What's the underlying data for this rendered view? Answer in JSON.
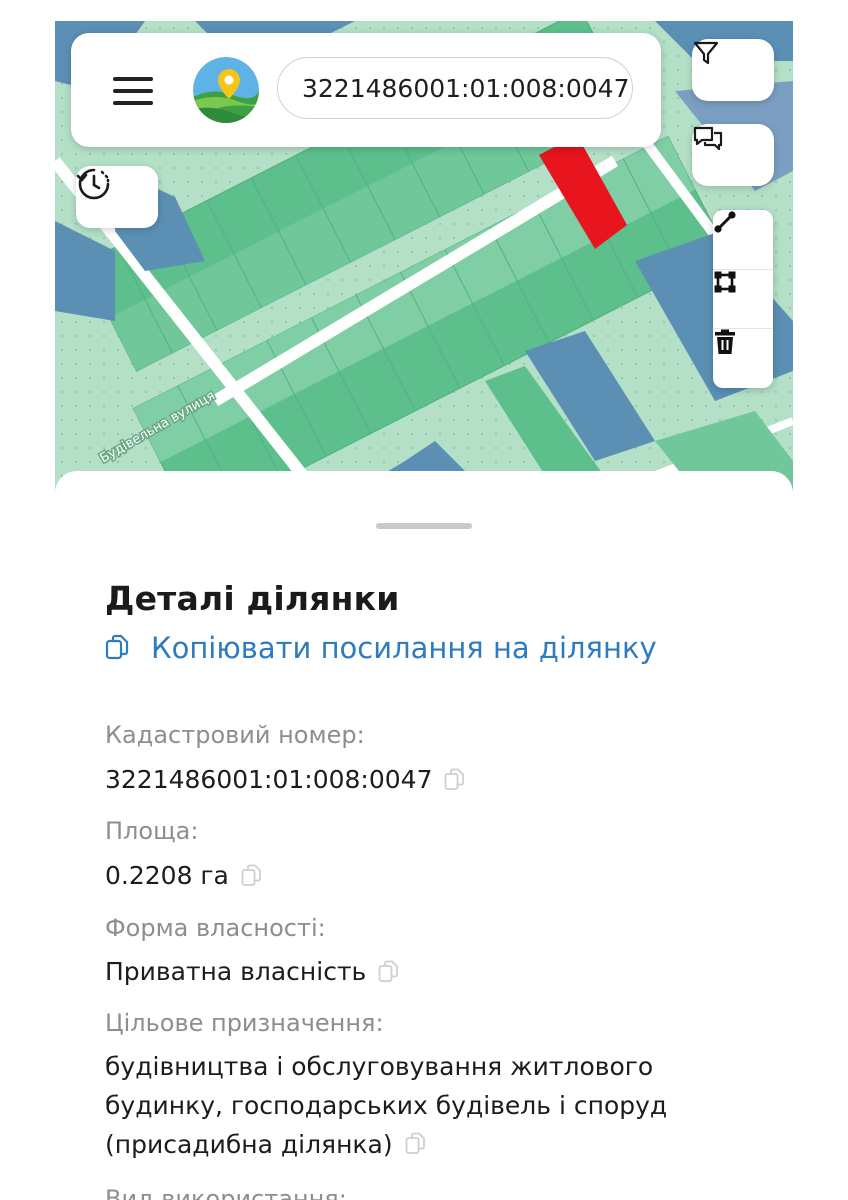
{
  "map": {
    "street_label": "Будівельна вулиця",
    "colors": {
      "parcel_green": "#5cbf8c",
      "parcel_light": "#7fcea6",
      "parcel_blue": "#5b8fb4",
      "selected_parcel": "#e8141e",
      "background": "#a9dcbf",
      "road": "#ffffff"
    }
  },
  "topbar": {
    "menu_icon": "hamburger-icon",
    "logo_icon": "map-pin-logo-icon",
    "search_value": "3221486001:01:008:0047"
  },
  "controls": {
    "history_icon": "history-clock-icon",
    "filter_icon": "filter-icon",
    "chat_icon": "chat-bubbles-icon",
    "line_tool_icon": "measure-line-icon",
    "area_tool_icon": "measure-area-icon",
    "delete_tool_icon": "trash-icon"
  },
  "details": {
    "title": "Деталі ділянки",
    "copy_link": "Копіювати посилання на ділянку",
    "fields": [
      {
        "label": "Кадастровий номер:",
        "value": "3221486001:01:008:0047"
      },
      {
        "label": "Площа:",
        "value": "0.2208 га"
      },
      {
        "label": "Форма власності:",
        "value": "Приватна власність"
      },
      {
        "label": "Цільове призначення:",
        "value": "будівництва і обслуговування житлового будинку, господарських будівель і споруд (присадибна ділянка)"
      },
      {
        "label": "Вид використання:"
      }
    ]
  }
}
